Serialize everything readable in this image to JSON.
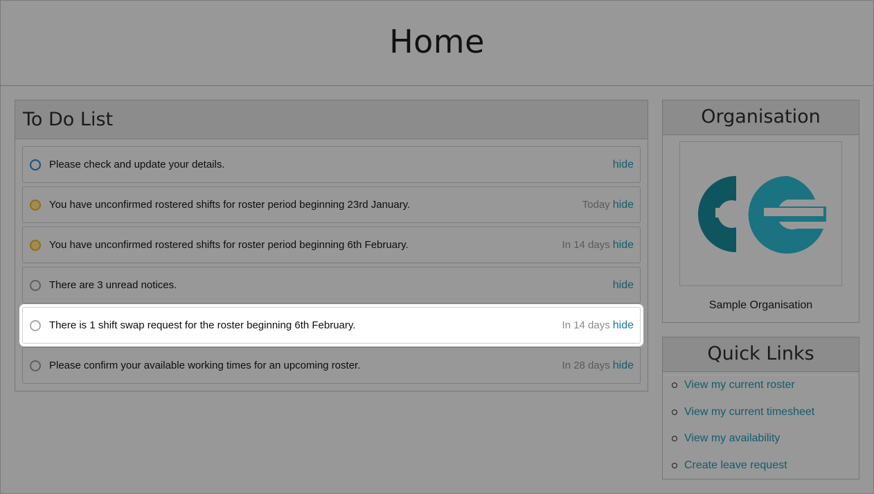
{
  "header": {
    "title": "Home"
  },
  "todo": {
    "title": "To Do List",
    "items": [
      {
        "text": "Please check and update your details.",
        "due": "",
        "hide": "hide",
        "status": "blue"
      },
      {
        "text": "You have unconfirmed rostered shifts for roster period beginning 23rd January.",
        "due": "Today",
        "hide": "hide",
        "status": "amber"
      },
      {
        "text": "You have unconfirmed rostered shifts for roster period beginning 6th February.",
        "due": "In 14 days",
        "hide": "hide",
        "status": "amber"
      },
      {
        "text": "There are 3 unread notices.",
        "due": "",
        "hide": "hide",
        "status": "grey"
      },
      {
        "text": "There is 1 shift swap request for the roster beginning 6th February.",
        "due": "In 14 days",
        "hide": "hide",
        "status": "grey"
      },
      {
        "text": "Please confirm your available working times for an upcoming roster.",
        "due": "In 28 days",
        "hide": "hide",
        "status": "grey"
      }
    ]
  },
  "organisation": {
    "title": "Organisation",
    "name": "Sample Organisation",
    "logo_icon": "ce-logo-icon"
  },
  "quick_links": {
    "title": "Quick Links",
    "items": [
      {
        "label": "View my current roster"
      },
      {
        "label": "View my current timesheet"
      },
      {
        "label": "View my availability"
      },
      {
        "label": "Create leave request"
      }
    ]
  },
  "colors": {
    "overlay_bg": "#989898",
    "link": "#155b6c",
    "focused_item_bg": "#ffffff",
    "logo_dark": "#0f5560",
    "logo_light": "#1b7280"
  }
}
